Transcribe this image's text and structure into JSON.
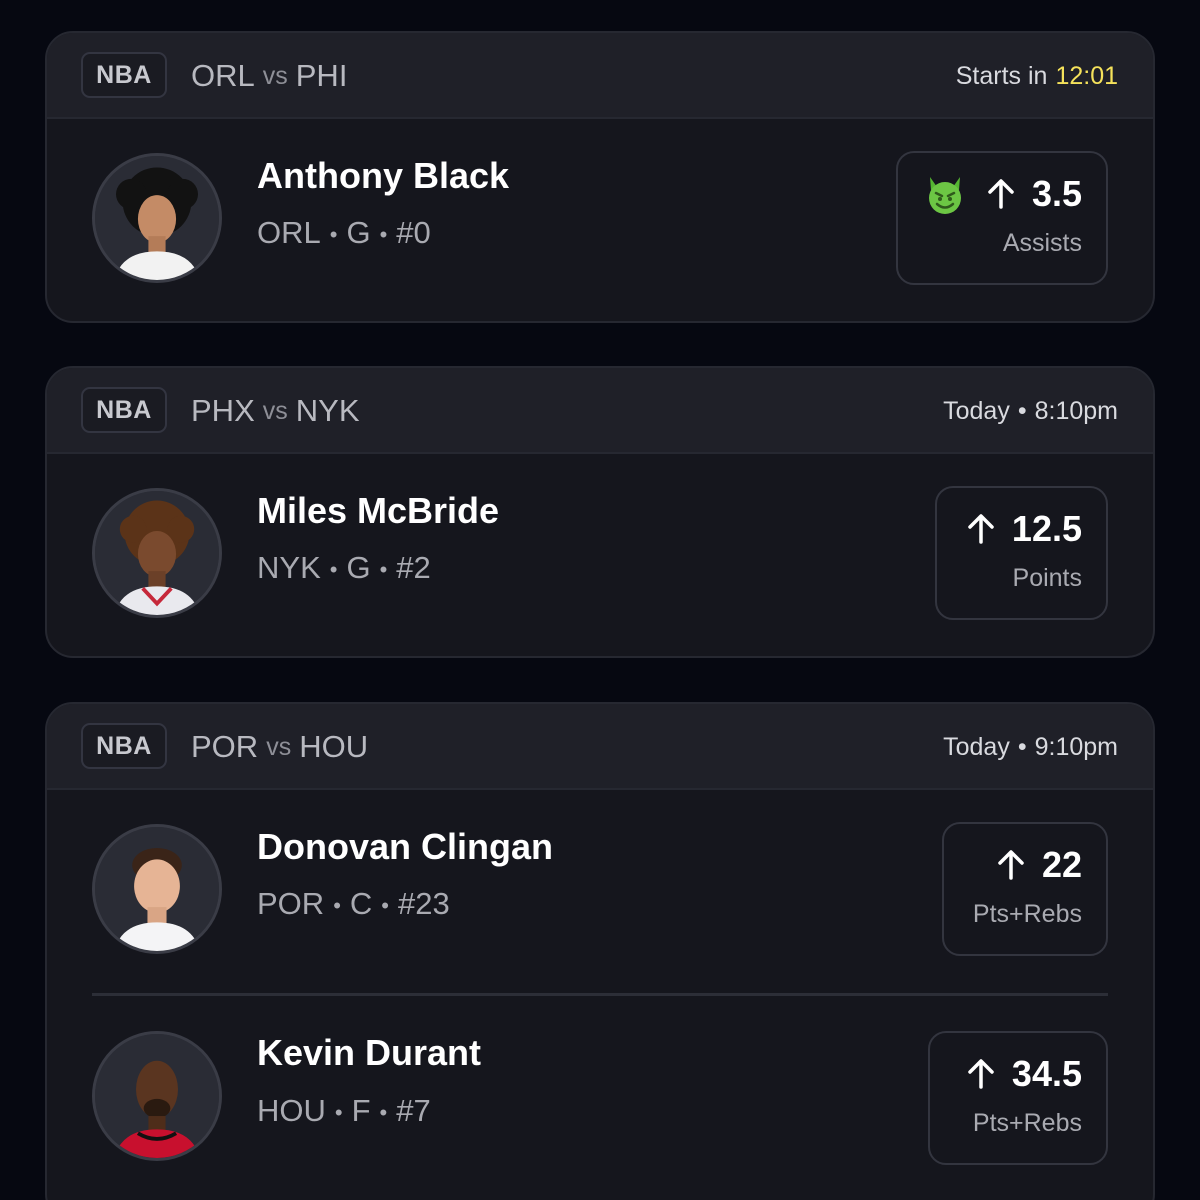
{
  "games": [
    {
      "league": "NBA",
      "away_team": "ORL",
      "vs": "vs",
      "home_team": "PHI",
      "time_prefix": "Starts in",
      "countdown": "12:01",
      "accent": "#f5e25b",
      "players": [
        {
          "name": "Anthony Black",
          "team": "ORL",
          "position": "G",
          "number": "#0",
          "line": "3.5",
          "stat": "Assists",
          "direction": "up-arrow-icon",
          "badge": "devil-emoji-icon"
        }
      ]
    },
    {
      "league": "NBA",
      "away_team": "PHX",
      "vs": "vs",
      "home_team": "NYK",
      "day": "Today",
      "time": "8:10pm",
      "players": [
        {
          "name": "Miles McBride",
          "team": "NYK",
          "position": "G",
          "number": "#2",
          "line": "12.5",
          "stat": "Points",
          "direction": "up-arrow-icon"
        }
      ]
    },
    {
      "league": "NBA",
      "away_team": "POR",
      "vs": "vs",
      "home_team": "HOU",
      "day": "Today",
      "time": "9:10pm",
      "players": [
        {
          "name": "Donovan Clingan",
          "team": "POR",
          "position": "C",
          "number": "#23",
          "line": "22",
          "stat": "Pts+Rebs",
          "direction": "up-arrow-icon"
        },
        {
          "name": "Kevin Durant",
          "team": "HOU",
          "position": "F",
          "number": "#7",
          "line": "34.5",
          "stat": "Pts+Rebs",
          "direction": "up-arrow-icon"
        }
      ]
    }
  ],
  "separator": "•"
}
